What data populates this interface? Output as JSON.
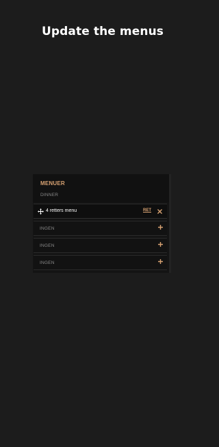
{
  "page": {
    "title": "Update the menus"
  },
  "panel": {
    "title": "MENUER",
    "subtitle": "DINNER",
    "active_item": {
      "label": "4 retters menu",
      "edit_label": "RET",
      "move_icon": "move-icon",
      "close_icon": "close-icon"
    },
    "items": [
      {
        "label": "INGEN",
        "icon": "plus-icon"
      },
      {
        "label": "INGEN",
        "icon": "plus-icon"
      },
      {
        "label": "INGEN",
        "icon": "plus-icon"
      }
    ]
  },
  "colors": {
    "background": "#1c1c1c",
    "accent": "#d9a373",
    "muted_text": "#8a8a8a",
    "panel": "#141414"
  }
}
